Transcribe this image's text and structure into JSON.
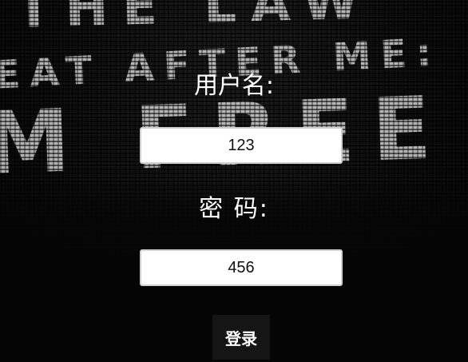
{
  "background": {
    "line1": "THE LAW",
    "line2": "EAT AFTER ME:",
    "line3": "M FREE"
  },
  "form": {
    "username_label": "用户名:",
    "username_value": "123",
    "password_label": "密 码:",
    "password_value": "456",
    "login_label": "登录"
  }
}
